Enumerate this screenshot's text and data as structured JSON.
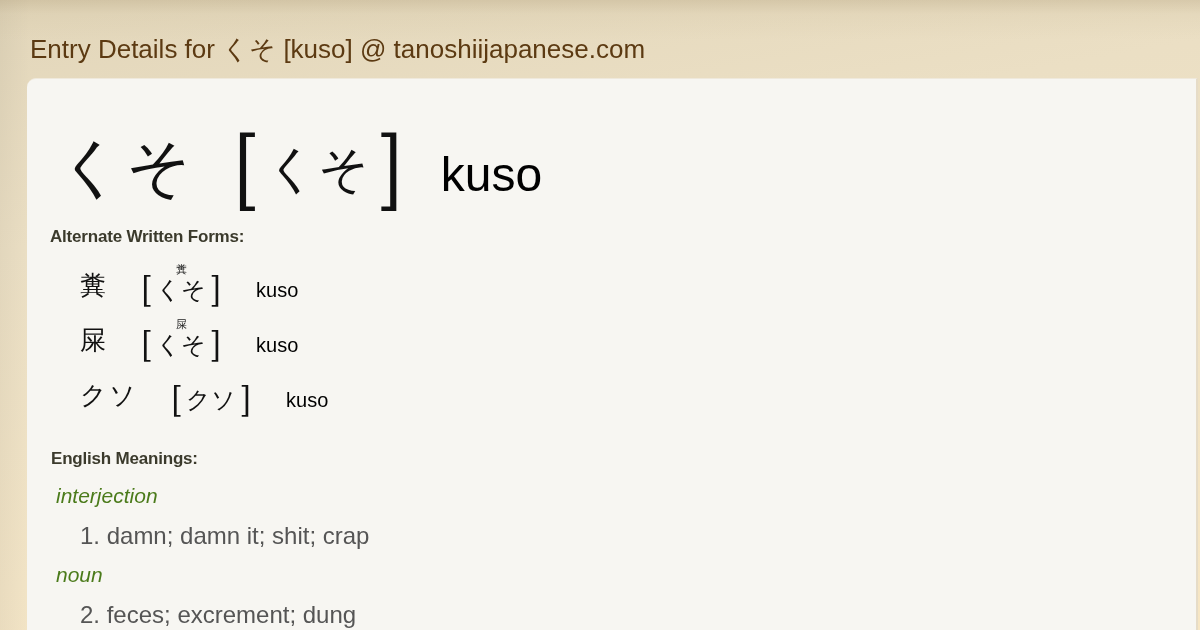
{
  "header": {
    "title": "Entry Details for くそ [kuso] @ tanoshiijapanese.com"
  },
  "entry": {
    "word": "くそ",
    "reading": {
      "open": "[",
      "text": "くそ",
      "close": "]"
    },
    "romaji": "kuso"
  },
  "alternate_forms": {
    "heading": "Alternate Written Forms:",
    "forms": [
      {
        "written": "糞",
        "furigana": "糞",
        "reading": {
          "open": "[",
          "text": "くそ",
          "close": "]"
        },
        "romaji": "kuso"
      },
      {
        "written": "屎",
        "furigana": "屎",
        "reading": {
          "open": "[",
          "text": "くそ",
          "close": "]"
        },
        "romaji": "kuso"
      },
      {
        "written": "クソ",
        "reading": {
          "open": "[",
          "text": "クソ",
          "close": "]"
        },
        "romaji": "kuso"
      }
    ]
  },
  "meanings": {
    "heading": "English Meanings:",
    "groups": [
      {
        "part_of_speech": "interjection",
        "senses": [
          "1. damn; damn it; shit; crap"
        ]
      },
      {
        "part_of_speech": "noun",
        "senses": [
          "2. feces; excrement; dung"
        ]
      }
    ]
  }
}
